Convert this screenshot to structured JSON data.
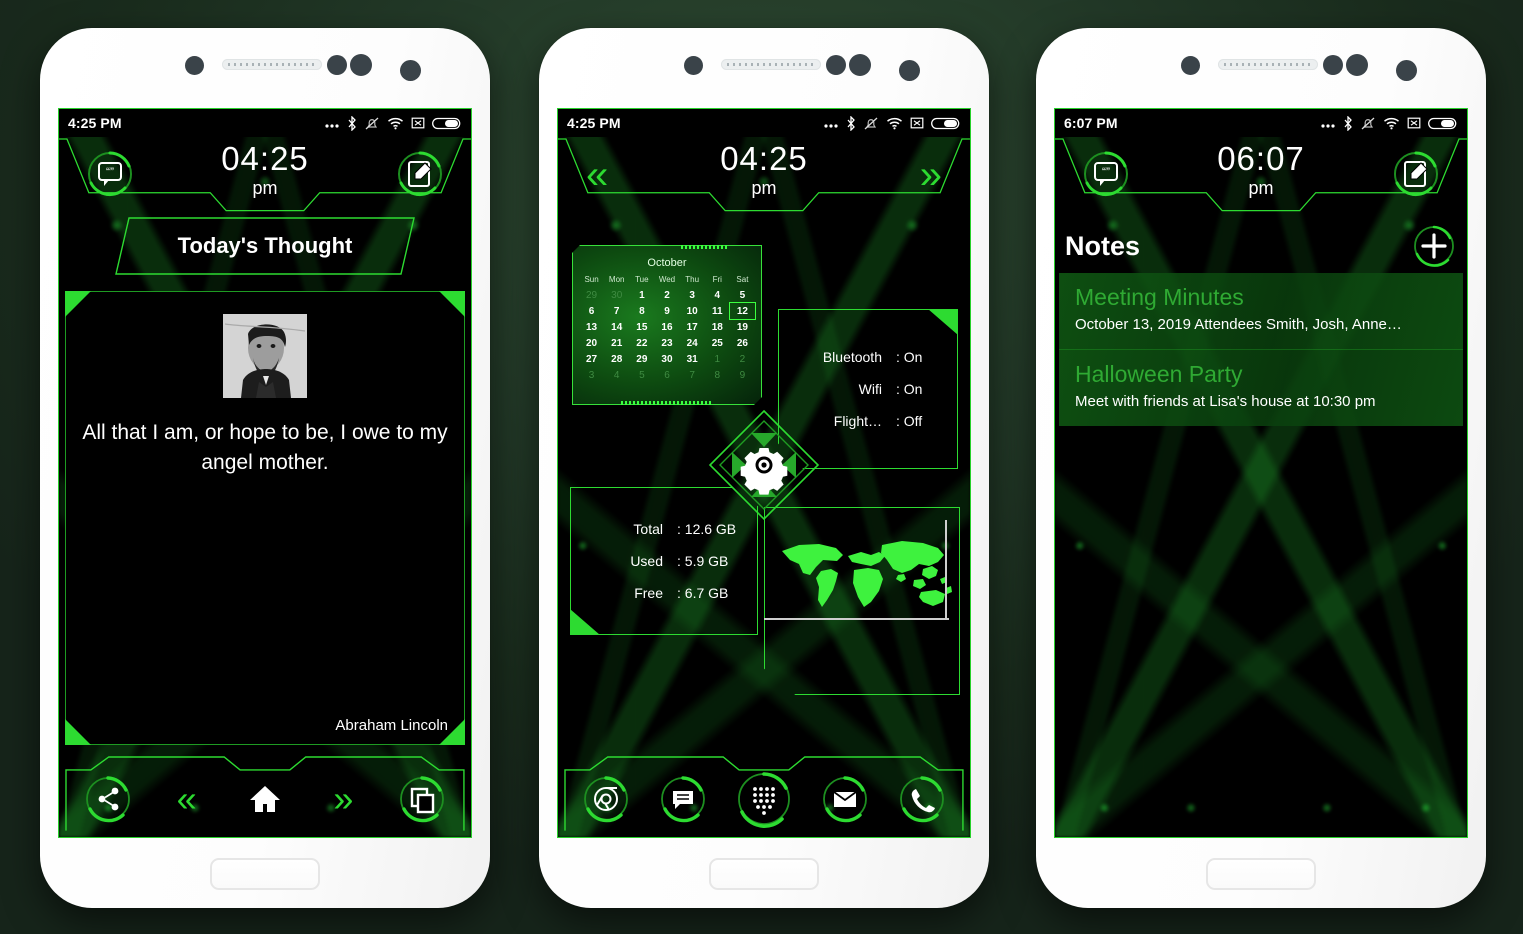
{
  "background_color": "#223827",
  "accent_color": "#2ddb31",
  "phones": [
    {
      "id": "phone-1",
      "status_bar": {
        "time": "4:25 PM",
        "icons": [
          "ellipsis-icon",
          "bluetooth-icon",
          "mute-bell-icon",
          "wifi-icon",
          "no-sim-icon",
          "battery-icon"
        ]
      },
      "header": {
        "time": "04:25",
        "meridiem": "pm",
        "left_icon": "quote-bubble-icon",
        "right_icon": "note-edit-icon"
      },
      "banner_title": "Today's Thought",
      "quote": {
        "portrait_alt": "abraham-lincoln-portrait",
        "text": "All that I am, or hope to be, I owe to my angel mother.",
        "author": "Abraham Lincoln"
      },
      "dock": [
        {
          "name": "share-icon",
          "style": "ring"
        },
        {
          "name": "chevron-double-left-icon",
          "style": "plain",
          "glyph": "«"
        },
        {
          "name": "home-icon",
          "style": "solid"
        },
        {
          "name": "chevron-double-right-icon",
          "style": "plain",
          "glyph": "»"
        },
        {
          "name": "recent-apps-icon",
          "style": "ring"
        }
      ]
    },
    {
      "id": "phone-2",
      "status_bar": {
        "time": "4:25 PM",
        "icons": [
          "ellipsis-icon",
          "bluetooth-icon",
          "mute-bell-icon",
          "wifi-icon",
          "no-sim-icon",
          "battery-icon"
        ]
      },
      "header": {
        "time": "04:25",
        "meridiem": "pm",
        "left_icon": "chevron-double-left-icon",
        "right_icon": "chevron-double-right-icon",
        "left_glyph": "«",
        "right_glyph": "»"
      },
      "calendar": {
        "month": "October",
        "dow": [
          "Sun",
          "Mon",
          "Tue",
          "Wed",
          "Thu",
          "Fri",
          "Sat"
        ],
        "today": 12,
        "weeks": [
          [
            {
              "n": 29,
              "dim": true
            },
            {
              "n": 30,
              "dim": true
            },
            {
              "n": 1
            },
            {
              "n": 2
            },
            {
              "n": 3
            },
            {
              "n": 4
            },
            {
              "n": 5
            }
          ],
          [
            {
              "n": 6
            },
            {
              "n": 7
            },
            {
              "n": 8
            },
            {
              "n": 9
            },
            {
              "n": 10
            },
            {
              "n": 11
            },
            {
              "n": 12,
              "today": true
            }
          ],
          [
            {
              "n": 13
            },
            {
              "n": 14
            },
            {
              "n": 15
            },
            {
              "n": 16
            },
            {
              "n": 17
            },
            {
              "n": 18
            },
            {
              "n": 19
            }
          ],
          [
            {
              "n": 20
            },
            {
              "n": 21
            },
            {
              "n": 22
            },
            {
              "n": 23
            },
            {
              "n": 24
            },
            {
              "n": 25
            },
            {
              "n": 26
            }
          ],
          [
            {
              "n": 27
            },
            {
              "n": 28
            },
            {
              "n": 29
            },
            {
              "n": 30
            },
            {
              "n": 31
            },
            {
              "n": 1,
              "dim": true
            },
            {
              "n": 2,
              "dim": true
            }
          ],
          [
            {
              "n": 3,
              "dim": true
            },
            {
              "n": 4,
              "dim": true
            },
            {
              "n": 5,
              "dim": true
            },
            {
              "n": 6,
              "dim": true
            },
            {
              "n": 7,
              "dim": true
            },
            {
              "n": 8,
              "dim": true
            },
            {
              "n": 9,
              "dim": true
            }
          ]
        ]
      },
      "toggles": [
        {
          "label": "Bluetooth",
          "value": ": On"
        },
        {
          "label": "Wifi",
          "value": ": On"
        },
        {
          "label": "Flight…",
          "value": ": Off"
        }
      ],
      "center_control": {
        "icon": "settings-gear-icon"
      },
      "storage": [
        {
          "label": "Total",
          "value": ": 12.6 GB"
        },
        {
          "label": "Used",
          "value": ": 5.9 GB"
        },
        {
          "label": "Free",
          "value": ": 6.7 GB"
        }
      ],
      "map_widget": {
        "icon": "world-map-icon"
      },
      "dock": [
        {
          "name": "browser-chrome-icon"
        },
        {
          "name": "messages-icon"
        },
        {
          "name": "app-drawer-icon"
        },
        {
          "name": "email-icon"
        },
        {
          "name": "phone-dialer-icon"
        }
      ]
    },
    {
      "id": "phone-3",
      "status_bar": {
        "time": "6:07 PM",
        "icons": [
          "ellipsis-icon",
          "bluetooth-icon",
          "mute-bell-icon",
          "wifi-icon",
          "no-sim-icon",
          "battery-icon"
        ]
      },
      "header": {
        "time": "06:07",
        "meridiem": "pm",
        "left_icon": "quote-bubble-icon",
        "right_icon": "note-edit-icon"
      },
      "notes_title": "Notes",
      "add_button": "add-note-icon",
      "notes": [
        {
          "title": "Meeting Minutes",
          "body": "October 13, 2019 Attendees Smith, Josh, Anne…"
        },
        {
          "title": "Halloween Party",
          "body": "Meet with friends at Lisa's house at 10:30 pm"
        }
      ]
    }
  ]
}
